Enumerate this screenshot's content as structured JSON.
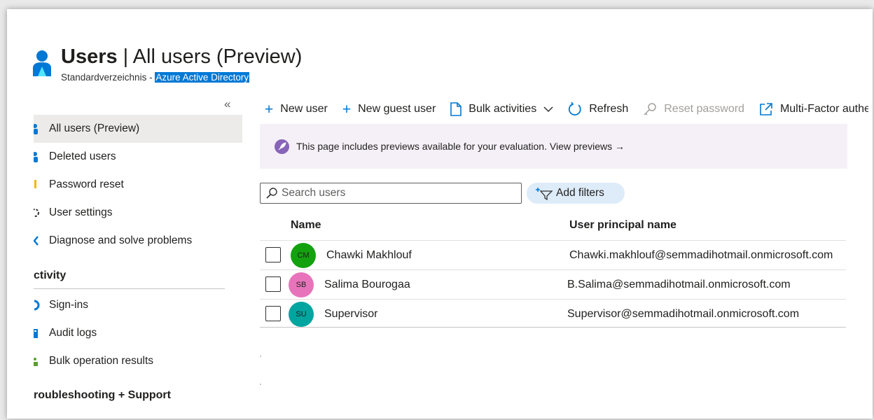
{
  "header": {
    "title_bold": "Users",
    "title_rest": " | All users (Preview)",
    "subtitle_prefix": "Standardverzeichnis - ",
    "subtitle_highlight": "Azure Active Directory"
  },
  "sidebar": {
    "collapse_glyph": "«",
    "items": [
      {
        "label": "All users (Preview)",
        "icon": "user-icon",
        "active": true
      },
      {
        "label": "Deleted users",
        "icon": "user-icon"
      },
      {
        "label": "Password reset",
        "icon": "key-icon"
      },
      {
        "label": "User settings",
        "icon": "gear-icon"
      },
      {
        "label": "Diagnose and solve problems",
        "icon": "wrench-icon"
      }
    ],
    "section_activity": "ctivity",
    "activity_items": [
      {
        "label": "Sign-ins",
        "icon": "sign-in-icon"
      },
      {
        "label": "Audit logs",
        "icon": "audit-icon"
      },
      {
        "label": "Bulk operation results",
        "icon": "bulk-icon"
      }
    ],
    "section_troubleshooting": "roubleshooting + Support"
  },
  "toolbar": {
    "new_user": "New user",
    "new_guest_user": "New guest user",
    "bulk_activities": "Bulk activities",
    "refresh": "Refresh",
    "reset_password": "Reset password",
    "multi_factor": "Multi-Factor authentication"
  },
  "banner": {
    "text": "This page includes previews available for your evaluation. View previews →"
  },
  "search": {
    "placeholder": "Search users"
  },
  "filters": {
    "label": "Add filters"
  },
  "table": {
    "columns": [
      "Name",
      "User principal name"
    ],
    "rows": [
      {
        "initials": "CM",
        "name": "Chawki Makhlouf",
        "upn": "Chawki.makhlouf@semmadihotmail.onmicrosoft.com",
        "avatar_color": "#13a10e"
      },
      {
        "initials": "SB",
        "name": "Salima Bourogaa",
        "upn": "B.Salima@semmadihotmail.onmicrosoft.com",
        "avatar_color": "#e774bb"
      },
      {
        "initials": "SU",
        "name": "Supervisor",
        "upn": "Supervisor@semmadihotmail.onmicrosoft.com",
        "avatar_color": "#00a5a0"
      }
    ]
  },
  "colors": {
    "accent": "#0078d4",
    "banner_bg": "#f5f0f7",
    "preview_icon": "#8764b8"
  }
}
